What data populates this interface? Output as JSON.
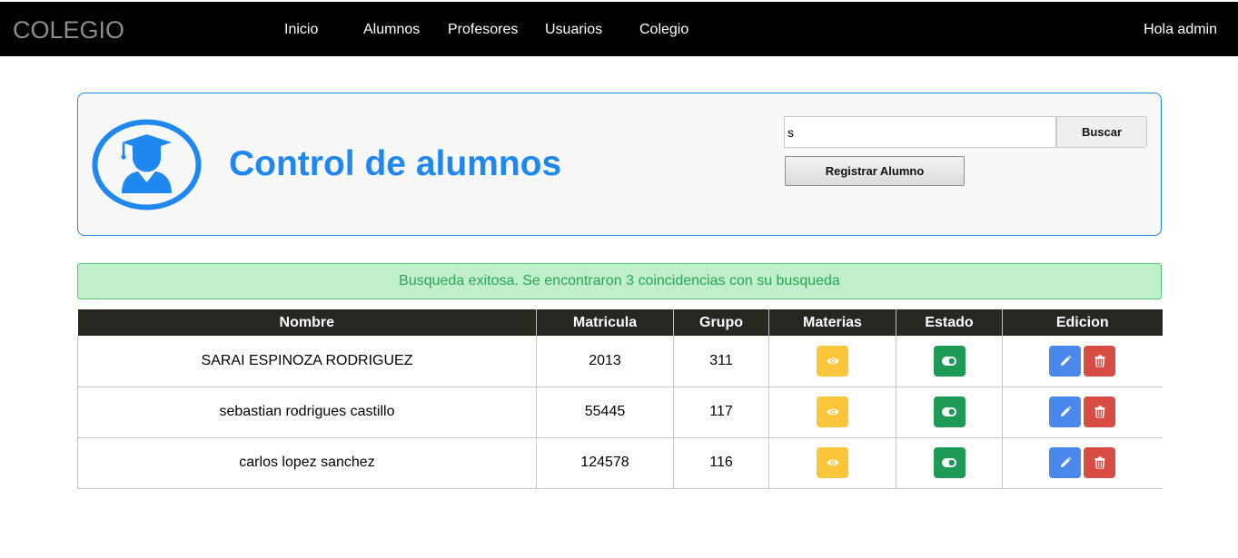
{
  "navbar": {
    "brand": "COLEGIO",
    "links": [
      "Inicio",
      "Alumnos",
      "Profesores",
      "Usuarios",
      "Colegio"
    ],
    "greeting": "Hola admin"
  },
  "header": {
    "title": "Control de alumnos",
    "search_value": "s",
    "search_button": "Buscar",
    "register_button": "Registrar Alumno"
  },
  "alert": {
    "message": "Busqueda exitosa. Se encontraron 3 coincidencias con su busqueda"
  },
  "table": {
    "columns": [
      "Nombre",
      "Matricula",
      "Grupo",
      "Materias",
      "Estado",
      "Edicion"
    ],
    "rows": [
      {
        "nombre": "SARAI ESPINOZA RODRIGUEZ",
        "matricula": "2013",
        "grupo": "311"
      },
      {
        "nombre": "sebastian rodrigues castillo",
        "matricula": "55445",
        "grupo": "117"
      },
      {
        "nombre": "carlos lopez sanchez",
        "matricula": "124578",
        "grupo": "116"
      }
    ]
  },
  "icons": {
    "materias": "eye-icon",
    "estado": "toggle-on-icon",
    "edit": "pencil-icon",
    "delete": "trash-icon",
    "avatar": "graduate-user-icon"
  },
  "colors": {
    "brand_blue": "#1e88f0",
    "alert_bg": "#bff0c8",
    "alert_text": "#27a559",
    "materias_btn": "#fbc63a",
    "estado_btn": "#1e9a57",
    "edit_btn": "#4a88ec",
    "delete_btn": "#d84d43",
    "table_header": "#272722"
  }
}
